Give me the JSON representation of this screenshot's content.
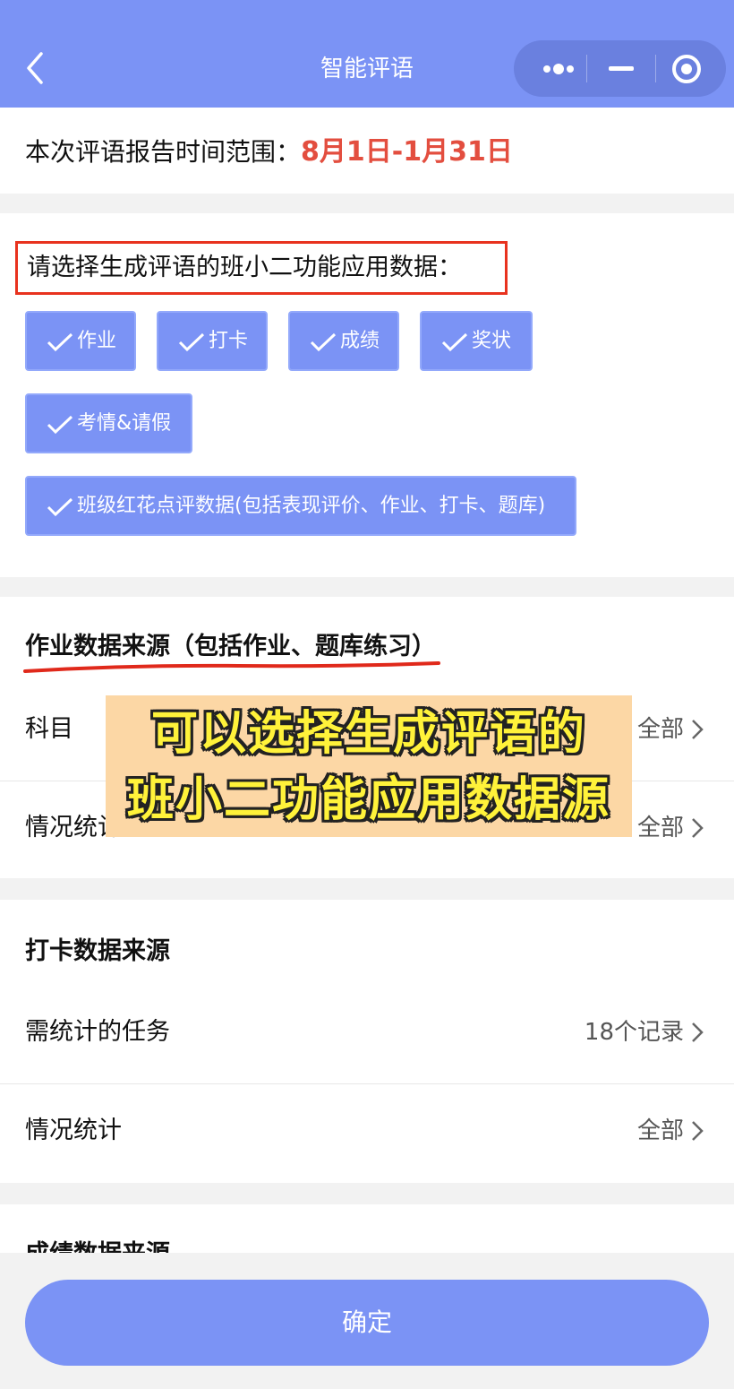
{
  "nav": {
    "title": "智能评语",
    "back_icon": "back-arrow-icon"
  },
  "range": {
    "label": "本次评语报告时间范围：",
    "value": "8月1日-1月31日",
    "value_color": "#e34e3f"
  },
  "select_title": "请选择生成评语的班小二功能应用数据：",
  "chips": [
    {
      "label": "作业",
      "checked": true
    },
    {
      "label": "打卡",
      "checked": true
    },
    {
      "label": "成绩",
      "checked": true
    },
    {
      "label": "奖状",
      "checked": true
    },
    {
      "label": "考情&请假",
      "checked": true
    },
    {
      "label": "班级红花点评数据(包括表现评价、作业、打卡、题库)",
      "checked": true
    }
  ],
  "homework_section": {
    "title": "作业数据来源（包括作业、题库练习）",
    "rows": [
      {
        "label": "科目",
        "value": "全部"
      },
      {
        "label": "情况统计",
        "value": "全部"
      }
    ]
  },
  "checkin_section": {
    "title": "打卡数据来源",
    "rows": [
      {
        "label": "需统计的任务",
        "value": "18个记录"
      },
      {
        "label": "情况统计",
        "value": "全部"
      }
    ]
  },
  "grades_section": {
    "title": "成绩数据来源"
  },
  "overlay": {
    "line1": "可以选择生成评语的",
    "line2": "班小二功能应用数据源"
  },
  "confirm_label": "确定",
  "colors": {
    "accent": "#7b93f5",
    "highlight_border": "#e8321e",
    "overlay_bg": "#fcd7a5",
    "overlay_text": "#fff23a"
  }
}
